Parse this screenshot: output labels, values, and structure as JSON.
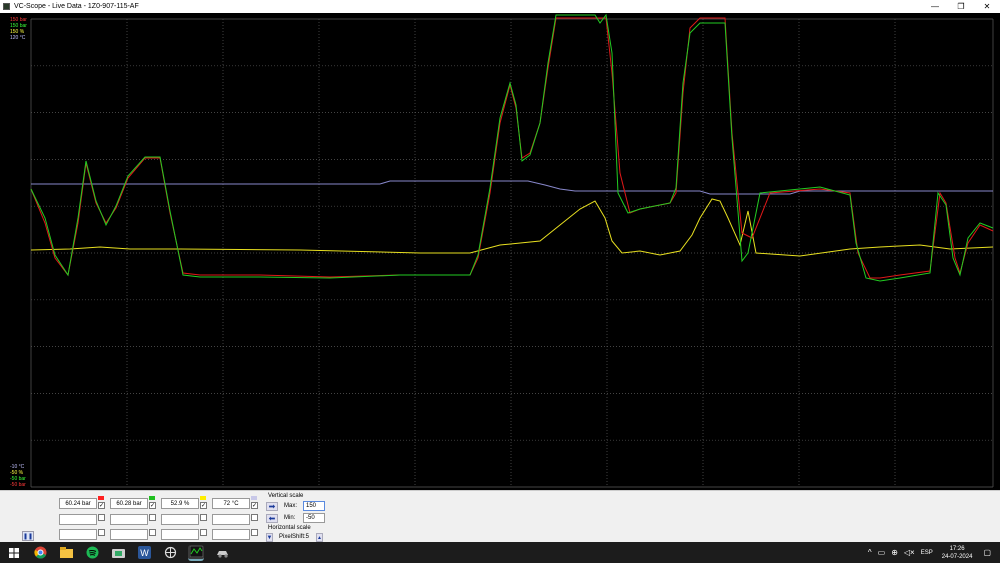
{
  "window": {
    "title": "VC-Scope  -  Live Data  -  1Z0-907-115-AF",
    "minimize": "—",
    "maximize": "❐",
    "close": "✕"
  },
  "scale_labels": {
    "top": [
      {
        "text": "150 bar",
        "color": "#ff3a3a"
      },
      {
        "text": "150 bar",
        "color": "#3aff3a"
      },
      {
        "text": "150 %",
        "color": "#ffff44"
      },
      {
        "text": "120 °C",
        "color": "#c0c0ff"
      }
    ],
    "bottom": [
      {
        "text": "-10 °C",
        "color": "#c0c0ff"
      },
      {
        "text": "-50 %",
        "color": "#ffff44"
      },
      {
        "text": "-50 bar",
        "color": "#3aff3a"
      },
      {
        "text": "-50 bar",
        "color": "#ff3a3a"
      }
    ]
  },
  "colors": {
    "red": "#e01818",
    "green": "#22cc22",
    "yellow": "#e8e020",
    "blue": "#8888cc",
    "grid": "#5a5a5a"
  },
  "channels": [
    {
      "value": "60.24 bar",
      "color": "#ff2020",
      "checked": true
    },
    {
      "value": "60.28 bar",
      "color": "#20c020",
      "checked": true
    },
    {
      "value": "52.9 %",
      "color": "#ffee00",
      "checked": true
    },
    {
      "value": "72 °C",
      "color": "#c8c8e8",
      "checked": true
    }
  ],
  "vertical_scale": {
    "label": "Vertical scale",
    "max_label": "Max:",
    "max_value": "150",
    "min_label": "Min:",
    "min_value": "-50"
  },
  "horizontal_scale": {
    "label": "Horizontal scale",
    "pixelshift": "PixelShift:5"
  },
  "pause_glyph": "❚❚",
  "clock": {
    "time": "17:26",
    "date": "24-07-2024"
  },
  "tray": {
    "language": "ESP"
  }
}
